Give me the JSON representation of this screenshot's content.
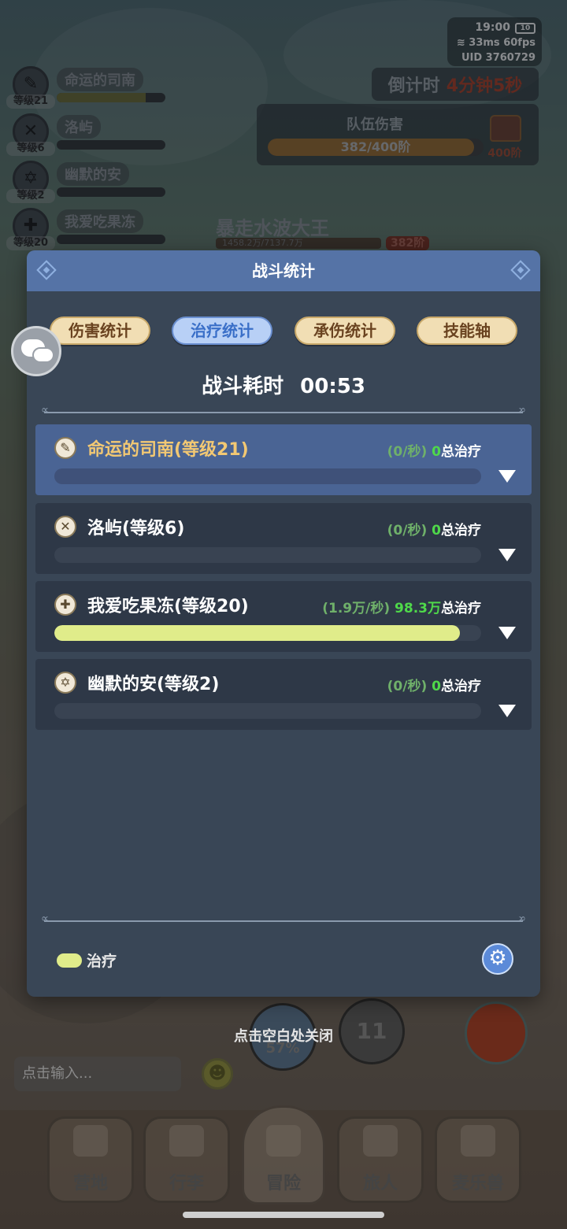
{
  "status": {
    "time": "19:00",
    "battery": "10",
    "ping": "33ms",
    "fps": "60fps",
    "uid_label": "UID",
    "uid": "3760729"
  },
  "countdown": {
    "label": "倒计时",
    "value": "4分钟5秒"
  },
  "team_damage": {
    "title": "队伍伤害",
    "progress_text": "382/400阶",
    "progress": 0.955,
    "reward_label": "400阶"
  },
  "party": [
    {
      "name": "命运的司南",
      "level": "等级21",
      "hp": 0.82,
      "icon": "compass-icon"
    },
    {
      "name": "洛屿",
      "level": "等级6",
      "hp": 0.0,
      "icon": "crossed-swords-icon"
    },
    {
      "name": "幽默的安",
      "level": "等级2",
      "hp": 0.0,
      "icon": "hexagram-icon"
    },
    {
      "name": "我爱吃果冻",
      "level": "等级20",
      "hp": 0.0,
      "icon": "cross-circle-icon"
    }
  ],
  "boss": {
    "name": "暴走水波大王",
    "hp_text": "1458.2万/7137.7万",
    "stage": "382阶"
  },
  "modal": {
    "title": "战斗统计",
    "tabs": [
      {
        "label": "伤害统计",
        "active": false
      },
      {
        "label": "治疗统计",
        "active": true
      },
      {
        "label": "承伤统计",
        "active": false
      },
      {
        "label": "技能轴",
        "active": false
      }
    ],
    "duration_label": "战斗耗时",
    "duration": "00:53",
    "rows": [
      {
        "name": "命运的司南(等级21)",
        "rate": "(0/秒)",
        "total": "0",
        "total_label": "总治疗",
        "fill": 0.0,
        "selected": true,
        "icon": "compass-icon"
      },
      {
        "name": "洛屿(等级6)",
        "rate": "(0/秒)",
        "total": "0",
        "total_label": "总治疗",
        "fill": 0.0,
        "selected": false,
        "icon": "crossed-swords-icon"
      },
      {
        "name": "我爱吃果冻(等级20)",
        "rate": "(1.9万/秒)",
        "total": "98.3万",
        "total_label": "总治疗",
        "fill": 0.95,
        "selected": false,
        "icon": "cross-circle-icon"
      },
      {
        "name": "幽默的安(等级2)",
        "rate": "(0/秒)",
        "total": "0",
        "total_label": "总治疗",
        "fill": 0.0,
        "selected": false,
        "icon": "hexagram-icon"
      }
    ],
    "legend_label": "治疗"
  },
  "close_hint": "点击空白处关闭",
  "chat_input": {
    "placeholder": "点击输入..."
  },
  "skills": {
    "skill1_text": "57%",
    "skill2_text": "11"
  },
  "nav": [
    {
      "label": "营地",
      "icon": "castle-icon"
    },
    {
      "label": "行李",
      "icon": "backpack-icon"
    },
    {
      "label": "冒险",
      "icon": "crossed-swords-icon"
    },
    {
      "label": "旅人",
      "icon": "character-icon"
    },
    {
      "label": "麦乐兽",
      "icon": "fox-icon"
    }
  ],
  "colors": {
    "modal_bg": "#394656",
    "header": "#5573a6",
    "heal_fill": "#e0ec8a",
    "tab_active": "#b8d0f6",
    "tab": "#f1deb4"
  }
}
